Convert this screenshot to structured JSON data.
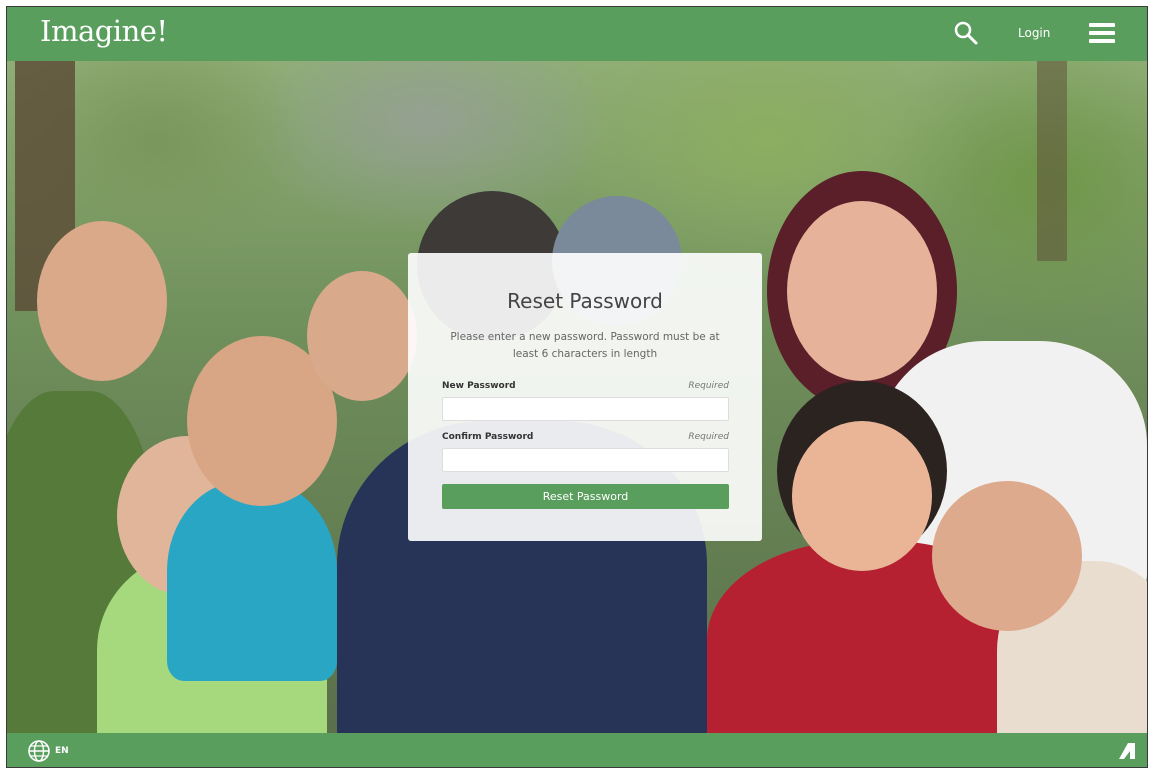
{
  "header": {
    "logo_text": "Imagine!",
    "login_label": "Login",
    "icons": {
      "search": "search-icon",
      "menu": "hamburger-menu-icon"
    }
  },
  "reset_form": {
    "title": "Reset Password",
    "description": "Please enter a new password. Password must be at least 6 characters in length",
    "new_password": {
      "label": "New Password",
      "required_text": "Required",
      "value": "",
      "placeholder": ""
    },
    "confirm_password": {
      "label": "Confirm Password",
      "required_text": "Required",
      "value": "",
      "placeholder": ""
    },
    "submit_label": "Reset Password"
  },
  "footer": {
    "language_code": "EN",
    "icons": {
      "language": "globe-icon",
      "brand": "brand-logo-icon"
    }
  },
  "colors": {
    "brand_green": "#5a9e5e",
    "panel_background": "#ffffff",
    "text_dark": "#444444"
  }
}
